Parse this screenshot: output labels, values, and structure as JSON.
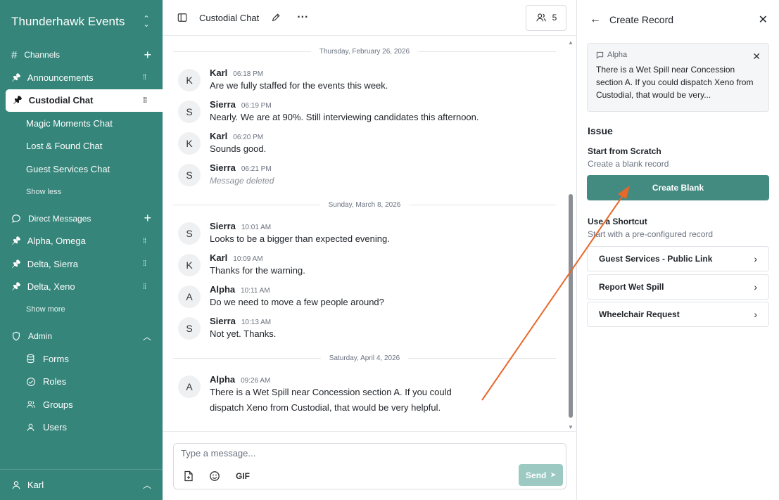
{
  "sidebar": {
    "workspace": "Thunderhawk Events",
    "channels_label": "Channels",
    "channels": [
      {
        "label": "Announcements",
        "pinned": true
      },
      {
        "label": "Custodial Chat",
        "pinned": true,
        "active": true
      },
      {
        "label": "Magic Moments Chat",
        "pinned": false
      },
      {
        "label": "Lost & Found Chat",
        "pinned": false
      },
      {
        "label": "Guest Services Chat",
        "pinned": false
      }
    ],
    "show_less": "Show less",
    "dm_label": "Direct Messages",
    "dms": [
      {
        "label": "Alpha, Omega"
      },
      {
        "label": "Delta, Sierra"
      },
      {
        "label": "Delta, Xeno"
      }
    ],
    "show_more": "Show more",
    "admin_label": "Admin",
    "admin_items": [
      {
        "label": "Forms",
        "icon": "database-icon"
      },
      {
        "label": "Roles",
        "icon": "check-circle-icon"
      },
      {
        "label": "Groups",
        "icon": "users-icon"
      },
      {
        "label": "Users",
        "icon": "user-icon"
      }
    ],
    "user": "Karl"
  },
  "chat": {
    "title": "Custodial Chat",
    "member_count": "5",
    "groups": [
      {
        "date": "Thursday, February 26, 2026",
        "messages": [
          {
            "initial": "K",
            "name": "Karl",
            "time": "06:18 PM",
            "text": "Are we fully staffed for the events this week.",
            "deleted": false
          },
          {
            "initial": "S",
            "name": "Sierra",
            "time": "06:19 PM",
            "text": "Nearly. We are at 90%. Still interviewing candidates this afternoon.",
            "deleted": false
          },
          {
            "initial": "K",
            "name": "Karl",
            "time": "06:20 PM",
            "text": "Sounds good.",
            "deleted": false
          },
          {
            "initial": "S",
            "name": "Sierra",
            "time": "06:21 PM",
            "text": "Message deleted",
            "deleted": true
          }
        ]
      },
      {
        "date": "Sunday, March 8, 2026",
        "messages": [
          {
            "initial": "S",
            "name": "Sierra",
            "time": "10:01 AM",
            "text": "Looks to be a bigger than expected evening.",
            "deleted": false
          },
          {
            "initial": "K",
            "name": "Karl",
            "time": "10:09 AM",
            "text": "Thanks for the warning.",
            "deleted": false
          },
          {
            "initial": "A",
            "name": "Alpha",
            "time": "10:11 AM",
            "text": "Do we need to move a few people around?",
            "deleted": false
          },
          {
            "initial": "S",
            "name": "Sierra",
            "time": "10:13 AM",
            "text": "Not yet. Thanks.",
            "deleted": false
          }
        ]
      },
      {
        "date": "Saturday, April 4, 2026",
        "messages": [
          {
            "initial": "A",
            "name": "Alpha",
            "time": "09:26 AM",
            "text": "There is a Wet Spill near Concession section A. If you could dispatch Xeno from Custodial, that would be very helpful.",
            "deleted": false
          }
        ]
      }
    ],
    "composer_placeholder": "Type a message...",
    "gif_label": "GIF",
    "send_label": "Send"
  },
  "panel": {
    "title": "Create Record",
    "quote_author": "Alpha",
    "quote_text": "There is a Wet Spill near Concession section A. If you could dispatch Xeno from Custodial, that would be very...",
    "record_type": "Issue",
    "scratch_title": "Start from Scratch",
    "scratch_desc": "Create a blank record",
    "blank_button": "Create Blank",
    "shortcut_title": "Use a Shortcut",
    "shortcut_desc": "Start with a pre-configured record",
    "shortcuts": [
      "Guest Services - Public Link",
      "Report Wet Spill",
      "Wheelchair Request"
    ]
  },
  "colors": {
    "brand": "#35857a",
    "button": "#438a80",
    "annotation_arrow": "#e8672a"
  }
}
